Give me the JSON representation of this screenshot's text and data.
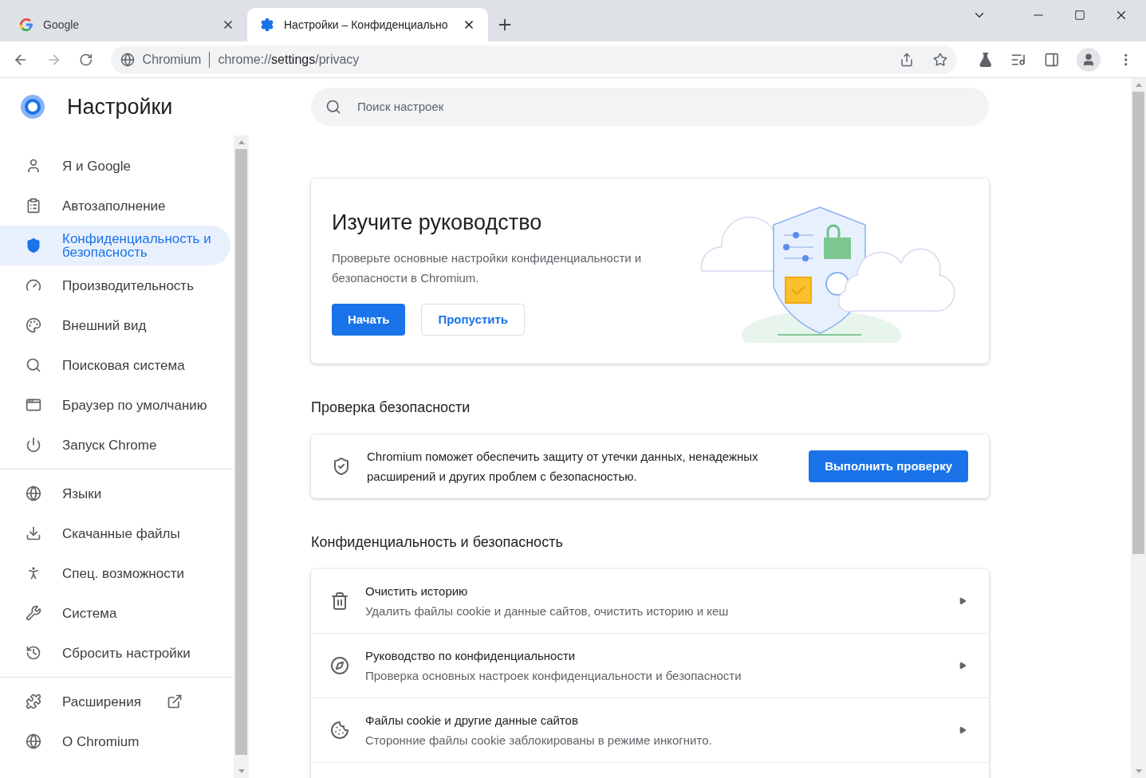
{
  "tabs": [
    {
      "title": "Google",
      "selected": false
    },
    {
      "title": "Настройки – Конфиденциально",
      "selected": true
    }
  ],
  "address_bar": {
    "site": "Chromium",
    "url_prefix": "chrome://",
    "url_host": "settings",
    "url_path": "/privacy"
  },
  "settings_title": "Настройки",
  "search": {
    "placeholder": "Поиск настроек"
  },
  "sidebar": {
    "groups": [
      [
        {
          "label": "Я и Google",
          "selected": false
        },
        {
          "label": "Автозаполнение",
          "selected": false
        },
        {
          "label": "Конфиденциальность и безопасность",
          "selected": true
        },
        {
          "label": "Производительность",
          "selected": false
        },
        {
          "label": "Внешний вид",
          "selected": false
        },
        {
          "label": "Поисковая система",
          "selected": false
        },
        {
          "label": "Браузер по умолчанию",
          "selected": false
        },
        {
          "label": "Запуск Chrome",
          "selected": false
        }
      ],
      [
        {
          "label": "Языки",
          "selected": false
        },
        {
          "label": "Скачанные файлы",
          "selected": false
        },
        {
          "label": "Спец. возможности",
          "selected": false
        },
        {
          "label": "Система",
          "selected": false
        },
        {
          "label": "Сбросить настройки",
          "selected": false
        }
      ],
      [
        {
          "label": "Расширения",
          "selected": false,
          "external": true
        },
        {
          "label": "О Chromium",
          "selected": false,
          "external": false
        }
      ]
    ]
  },
  "guide_card": {
    "title": "Изучите руководство",
    "text": "Проверьте основные настройки конфиденциальности и безопасности в Chromium.",
    "primary_button": "Начать",
    "secondary_button": "Пропустить"
  },
  "safety_check": {
    "heading": "Проверка безопасности",
    "text": "Chromium поможет обеспечить защиту от утечки данных, ненадежных расширений и других проблем с безопасностью.",
    "button": "Выполнить проверку"
  },
  "privacy_section": {
    "heading": "Конфиденциальность и безопасность",
    "rows": [
      {
        "title": "Очистить историю",
        "subtitle": "Удалить файлы cookie и данные сайтов, очистить историю и кеш"
      },
      {
        "title": "Руководство по конфиденциальности",
        "subtitle": "Проверка основных настроек конфиденциальности и безопасности"
      },
      {
        "title": "Файлы cookie и другие данные сайтов",
        "subtitle": "Сторонние файлы cookie заблокированы в режиме инкогнито."
      }
    ]
  }
}
